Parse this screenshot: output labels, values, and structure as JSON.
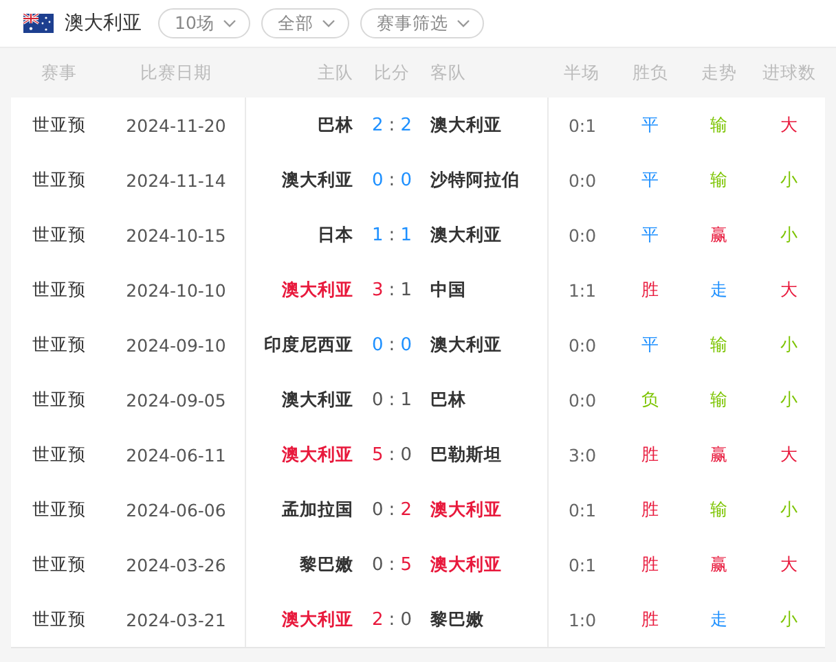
{
  "team": {
    "name": "澳大利亚"
  },
  "filters": [
    {
      "label": "10场"
    },
    {
      "label": "全部"
    },
    {
      "label": "赛事筛选"
    }
  ],
  "table": {
    "columns": [
      "赛事",
      "比赛日期",
      "主队",
      "比分",
      "客队",
      "半场",
      "胜负",
      "走势",
      "进球数"
    ],
    "rows": [
      {
        "league": "世亚预",
        "date": "2024-11-20",
        "home": {
          "name": "巴林",
          "color": "#333333"
        },
        "home_score": {
          "text": "2",
          "color": "#1e90ff"
        },
        "score_sep": ":",
        "away_score": {
          "text": "2",
          "color": "#1e90ff"
        },
        "away": {
          "name": "澳大利亚",
          "color": "#333333"
        },
        "half": "0:1",
        "result": {
          "text": "平",
          "color": "#1e90ff"
        },
        "trend": {
          "text": "输",
          "color": "#7cc400"
        },
        "goals": {
          "text": "大",
          "color": "#e8193c"
        }
      },
      {
        "league": "世亚预",
        "date": "2024-11-14",
        "home": {
          "name": "澳大利亚",
          "color": "#333333"
        },
        "home_score": {
          "text": "0",
          "color": "#1e90ff"
        },
        "score_sep": ":",
        "away_score": {
          "text": "0",
          "color": "#1e90ff"
        },
        "away": {
          "name": "沙特阿拉伯",
          "color": "#333333"
        },
        "half": "0:0",
        "result": {
          "text": "平",
          "color": "#1e90ff"
        },
        "trend": {
          "text": "输",
          "color": "#7cc400"
        },
        "goals": {
          "text": "小",
          "color": "#7cc400"
        }
      },
      {
        "league": "世亚预",
        "date": "2024-10-15",
        "home": {
          "name": "日本",
          "color": "#333333"
        },
        "home_score": {
          "text": "1",
          "color": "#1e90ff"
        },
        "score_sep": ":",
        "away_score": {
          "text": "1",
          "color": "#1e90ff"
        },
        "away": {
          "name": "澳大利亚",
          "color": "#333333"
        },
        "half": "0:0",
        "result": {
          "text": "平",
          "color": "#1e90ff"
        },
        "trend": {
          "text": "赢",
          "color": "#e8193c"
        },
        "goals": {
          "text": "小",
          "color": "#7cc400"
        }
      },
      {
        "league": "世亚预",
        "date": "2024-10-10",
        "home": {
          "name": "澳大利亚",
          "color": "#e8193c"
        },
        "home_score": {
          "text": "3",
          "color": "#e8193c"
        },
        "score_sep": ":",
        "away_score": {
          "text": "1",
          "color": "#555555"
        },
        "away": {
          "name": "中国",
          "color": "#333333"
        },
        "half": "1:1",
        "result": {
          "text": "胜",
          "color": "#e8193c"
        },
        "trend": {
          "text": "走",
          "color": "#1e90ff"
        },
        "goals": {
          "text": "大",
          "color": "#e8193c"
        }
      },
      {
        "league": "世亚预",
        "date": "2024-09-10",
        "home": {
          "name": "印度尼西亚",
          "color": "#333333"
        },
        "home_score": {
          "text": "0",
          "color": "#1e90ff"
        },
        "score_sep": ":",
        "away_score": {
          "text": "0",
          "color": "#1e90ff"
        },
        "away": {
          "name": "澳大利亚",
          "color": "#333333"
        },
        "half": "0:0",
        "result": {
          "text": "平",
          "color": "#1e90ff"
        },
        "trend": {
          "text": "输",
          "color": "#7cc400"
        },
        "goals": {
          "text": "小",
          "color": "#7cc400"
        }
      },
      {
        "league": "世亚预",
        "date": "2024-09-05",
        "home": {
          "name": "澳大利亚",
          "color": "#333333"
        },
        "home_score": {
          "text": "0",
          "color": "#555555"
        },
        "score_sep": ":",
        "away_score": {
          "text": "1",
          "color": "#555555"
        },
        "away": {
          "name": "巴林",
          "color": "#333333"
        },
        "half": "0:0",
        "result": {
          "text": "负",
          "color": "#7cc400"
        },
        "trend": {
          "text": "输",
          "color": "#7cc400"
        },
        "goals": {
          "text": "小",
          "color": "#7cc400"
        }
      },
      {
        "league": "世亚预",
        "date": "2024-06-11",
        "home": {
          "name": "澳大利亚",
          "color": "#e8193c"
        },
        "home_score": {
          "text": "5",
          "color": "#e8193c"
        },
        "score_sep": ":",
        "away_score": {
          "text": "0",
          "color": "#555555"
        },
        "away": {
          "name": "巴勒斯坦",
          "color": "#333333"
        },
        "half": "3:0",
        "result": {
          "text": "胜",
          "color": "#e8193c"
        },
        "trend": {
          "text": "赢",
          "color": "#e8193c"
        },
        "goals": {
          "text": "大",
          "color": "#e8193c"
        }
      },
      {
        "league": "世亚预",
        "date": "2024-06-06",
        "home": {
          "name": "孟加拉国",
          "color": "#333333"
        },
        "home_score": {
          "text": "0",
          "color": "#555555"
        },
        "score_sep": ":",
        "away_score": {
          "text": "2",
          "color": "#e8193c"
        },
        "away": {
          "name": "澳大利亚",
          "color": "#e8193c"
        },
        "half": "0:1",
        "result": {
          "text": "胜",
          "color": "#e8193c"
        },
        "trend": {
          "text": "输",
          "color": "#7cc400"
        },
        "goals": {
          "text": "小",
          "color": "#7cc400"
        }
      },
      {
        "league": "世亚预",
        "date": "2024-03-26",
        "home": {
          "name": "黎巴嫩",
          "color": "#333333"
        },
        "home_score": {
          "text": "0",
          "color": "#555555"
        },
        "score_sep": ":",
        "away_score": {
          "text": "5",
          "color": "#e8193c"
        },
        "away": {
          "name": "澳大利亚",
          "color": "#e8193c"
        },
        "half": "0:1",
        "result": {
          "text": "胜",
          "color": "#e8193c"
        },
        "trend": {
          "text": "赢",
          "color": "#e8193c"
        },
        "goals": {
          "text": "大",
          "color": "#e8193c"
        }
      },
      {
        "league": "世亚预",
        "date": "2024-03-21",
        "home": {
          "name": "澳大利亚",
          "color": "#e8193c"
        },
        "home_score": {
          "text": "2",
          "color": "#e8193c"
        },
        "score_sep": ":",
        "away_score": {
          "text": "0",
          "color": "#555555"
        },
        "away": {
          "name": "黎巴嫩",
          "color": "#333333"
        },
        "half": "1:0",
        "result": {
          "text": "胜",
          "color": "#e8193c"
        },
        "trend": {
          "text": "走",
          "color": "#1e90ff"
        },
        "goals": {
          "text": "小",
          "color": "#7cc400"
        }
      }
    ]
  }
}
